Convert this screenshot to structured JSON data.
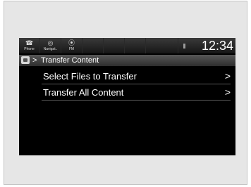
{
  "status_bar": {
    "icons": [
      {
        "name": "phone-icon",
        "glyph": "☎",
        "label": "Phone"
      },
      {
        "name": "navigation-icon",
        "glyph": "◎",
        "label": "Navigat.."
      },
      {
        "name": "fm-icon",
        "glyph": "⦿",
        "label": "FM"
      }
    ],
    "clock": "12:34"
  },
  "breadcrumb": {
    "separator": ">",
    "title": "Transfer Content"
  },
  "menu": {
    "items": [
      {
        "label": "Select Files to Transfer",
        "chevron": ">"
      },
      {
        "label": "Transfer All Content",
        "chevron": ">"
      }
    ]
  },
  "colors": {
    "screen_background": "#000000",
    "text": "#ffffff",
    "frame_background": "#e6e6e6"
  }
}
